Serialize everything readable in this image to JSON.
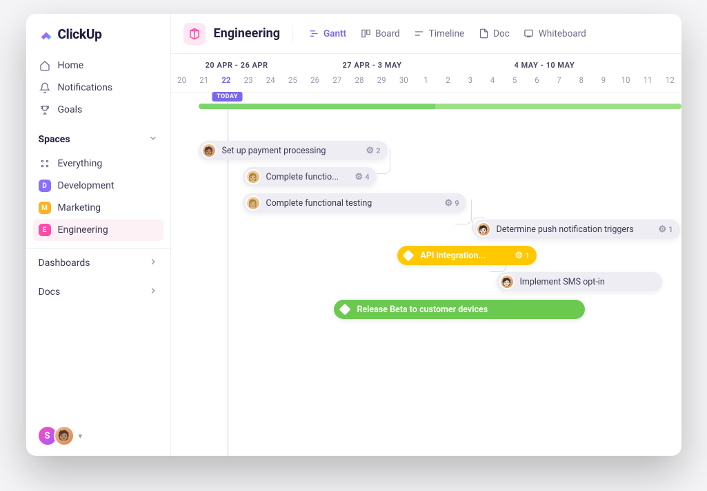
{
  "brand": "ClickUp",
  "nav": {
    "home": "Home",
    "notifications": "Notifications",
    "goals": "Goals"
  },
  "spaces": {
    "header": "Spaces",
    "everything": "Everything",
    "items": [
      {
        "initial": "D",
        "label": "Development",
        "color": "#8a6fff"
      },
      {
        "initial": "M",
        "label": "Marketing",
        "color": "#ffb020"
      },
      {
        "initial": "E",
        "label": "Engineering",
        "color": "#ff4aa8"
      }
    ]
  },
  "sections": {
    "dashboards": "Dashboards",
    "docs": "Docs"
  },
  "user": {
    "initial": "S"
  },
  "workspace": {
    "title": "Engineering",
    "views": {
      "gantt": "Gantt",
      "board": "Board",
      "timeline": "Timeline",
      "doc": "Doc",
      "whiteboard": "Whiteboard"
    }
  },
  "timeline": {
    "ranges": [
      "20 APR - 26 APR",
      "27 APR - 3 MAY",
      "4 MAY - 10 MAY"
    ],
    "days": [
      "20",
      "21",
      "22",
      "23",
      "24",
      "25",
      "26",
      "27",
      "28",
      "29",
      "30",
      "1",
      "2",
      "3",
      "4",
      "5",
      "6",
      "7",
      "8",
      "9",
      "10",
      "11",
      "12"
    ],
    "today_label": "TODAY",
    "today_index": 2
  },
  "tasks": [
    {
      "label": "Set up payment processing",
      "count": "2"
    },
    {
      "label": "Complete functio...",
      "count": "4"
    },
    {
      "label": "Complete functional testing",
      "count": "9"
    },
    {
      "label": "Determine push notification triggers",
      "count": "1"
    },
    {
      "label": "API integration...",
      "count": "1"
    },
    {
      "label": "Implement SMS opt-in",
      "count": ""
    },
    {
      "label": "Release Beta to customer devices",
      "count": ""
    }
  ]
}
